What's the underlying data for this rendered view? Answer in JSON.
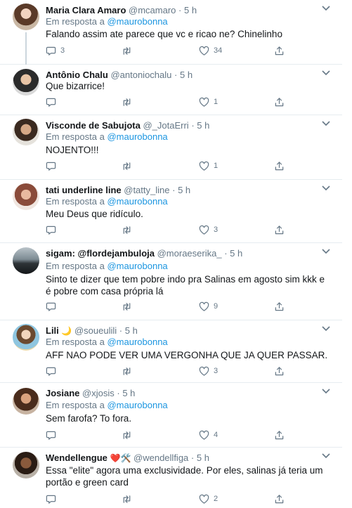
{
  "reply_prefix": "Em resposta a",
  "tweets": [
    {
      "name": "Maria Clara Amaro",
      "handle": "@mcamaro",
      "dot": "·",
      "time": "5 h",
      "reply_to": "@maurobonna",
      "text": "Falando assim ate parece que vc e ricao ne? Chinelinho",
      "replies": "3",
      "retweets": "",
      "likes": "34"
    },
    {
      "name": "Antônio Chalu",
      "handle": "@antoniochalu",
      "dot": "·",
      "time": "5 h",
      "reply_to": "",
      "text": "Que bizarrice!",
      "replies": "",
      "retweets": "",
      "likes": "1"
    },
    {
      "name": "Visconde de Sabujota",
      "handle": "@_JotaErri",
      "dot": "·",
      "time": "5 h",
      "reply_to": "@maurobonna",
      "text": "NOJENTO!!!",
      "replies": "",
      "retweets": "",
      "likes": "1"
    },
    {
      "name": "tati underline line",
      "handle": "@tatty_line",
      "dot": "·",
      "time": "5 h",
      "reply_to": "@maurobonna",
      "text": "Meu Deus que ridículo.",
      "replies": "",
      "retweets": "",
      "likes": "3"
    },
    {
      "name": "sigam: @flordejambuloja",
      "handle": "@moraeserika_",
      "dot": "·",
      "time": "5 h",
      "reply_to": "@maurobonna",
      "text": "Sinto te dizer  que tem pobre indo pra Salinas em agosto sim kkk e é pobre com casa própria lá",
      "replies": "",
      "retweets": "",
      "likes": "9"
    },
    {
      "name": "Lili",
      "name_emoji": "🌙",
      "handle": "@soueulili",
      "dot": "·",
      "time": "5 h",
      "reply_to": "@maurobonna",
      "text": "AFF NAO PODE VER UMA VERGONHA QUE JA QUER PASSAR.",
      "replies": "",
      "retweets": "",
      "likes": "3"
    },
    {
      "name": "Josiane",
      "handle": "@xjosis",
      "dot": "·",
      "time": "5 h",
      "reply_to": "@maurobonna",
      "text": "Sem farofa? To fora.",
      "replies": "",
      "retweets": "",
      "likes": "4"
    },
    {
      "name": "Wendellengue",
      "name_emoji": "❤️🛠️",
      "handle": "@wendellfiga",
      "dot": "·",
      "time": "5 h",
      "reply_to": "",
      "text": "Essa \"elite\" agora uma exclusividade. Por eles, salinas já teria um portão e green card",
      "replies": "",
      "retweets": "",
      "likes": "2"
    }
  ]
}
